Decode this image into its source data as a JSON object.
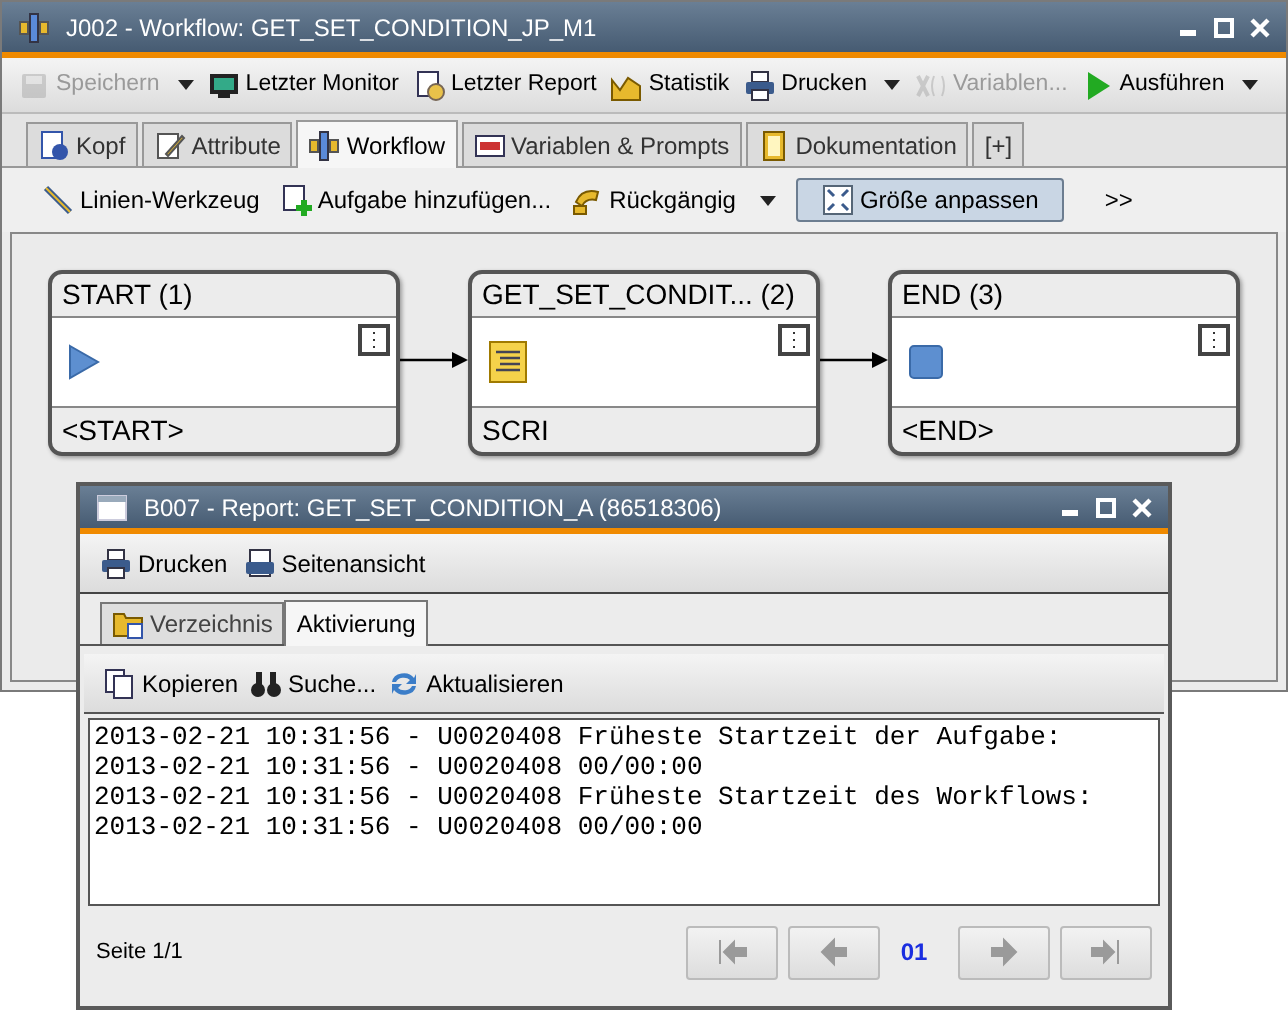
{
  "main_window": {
    "title": "J002 - Workflow: GET_SET_CONDITION_JP_M1",
    "toolbar": [
      {
        "label": "Speichern",
        "disabled": true,
        "dropdown": true
      },
      {
        "label": "Letzter Monitor",
        "disabled": false,
        "dropdown": false
      },
      {
        "label": "Letzter Report",
        "disabled": false,
        "dropdown": false
      },
      {
        "label": "Statistik",
        "disabled": false,
        "dropdown": false
      },
      {
        "label": "Drucken",
        "disabled": false,
        "dropdown": true
      },
      {
        "label": "Variablen...",
        "disabled": true,
        "dropdown": false
      },
      {
        "label": "Ausführen",
        "disabled": false,
        "dropdown": true
      }
    ],
    "tabs": [
      {
        "label": "Kopf",
        "selected": false
      },
      {
        "label": "Attribute",
        "selected": false
      },
      {
        "label": "Workflow",
        "selected": true
      },
      {
        "label": "Variablen & Prompts",
        "selected": false
      },
      {
        "label": "Dokumentation",
        "selected": false
      },
      {
        "label": "[+]",
        "selected": false
      }
    ],
    "workflow_toolbar": [
      {
        "label": "Linien-Werkzeug",
        "pressed": false,
        "dropdown": false
      },
      {
        "label": "Aufgabe hinzufügen...",
        "pressed": false,
        "dropdown": false
      },
      {
        "label": "Rückgängig",
        "pressed": false,
        "dropdown": true
      },
      {
        "label": "Größe anpassen",
        "pressed": true,
        "dropdown": false
      },
      {
        "label": ">>",
        "pressed": false,
        "dropdown": false
      }
    ],
    "nodes": [
      {
        "title": "START (1)",
        "kind": "start",
        "footer": "<START>"
      },
      {
        "title": "GET_SET_CONDIT... (2)",
        "kind": "script",
        "footer": "SCRI"
      },
      {
        "title": "END (3)",
        "kind": "end",
        "footer": "<END>"
      }
    ]
  },
  "report_window": {
    "title": "B007 - Report: GET_SET_CONDITION_A (86518306)",
    "toolbar": [
      "Drucken",
      "Seitenansicht"
    ],
    "tabs": [
      {
        "label": "Verzeichnis",
        "selected": false
      },
      {
        "label": "Aktivierung",
        "selected": true
      }
    ],
    "actions": [
      "Kopieren",
      "Suche...",
      "Aktualisieren"
    ],
    "log_lines": [
      "2013-02-21 10:31:56 - U0020408 Früheste Startzeit der Aufgabe:",
      "2013-02-21 10:31:56 - U0020408 00/00:00",
      "2013-02-21 10:31:56 - U0020408 Früheste Startzeit des Workflows:",
      "2013-02-21 10:31:56 - U0020408 00/00:00"
    ],
    "page_label": "Seite 1/1",
    "page_number": "01",
    "pager": [
      {
        "kind": "first",
        "disabled": true
      },
      {
        "kind": "prev",
        "disabled": true
      },
      {
        "kind": "next",
        "disabled": true
      },
      {
        "kind": "last",
        "disabled": true
      }
    ]
  }
}
